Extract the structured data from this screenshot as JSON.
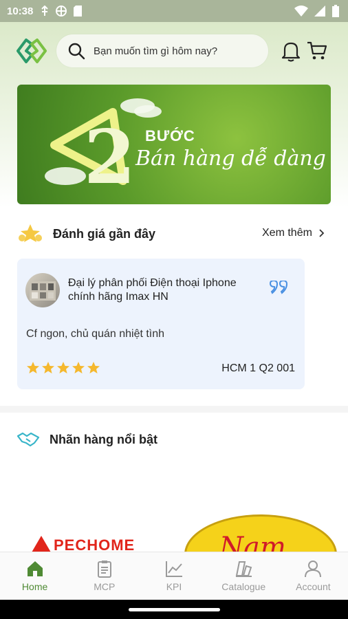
{
  "status_bar": {
    "time": "10:38"
  },
  "search": {
    "placeholder": "Bạn muốn tìm gì hôm nay?"
  },
  "banner": {
    "number": "2",
    "step_word": "BƯỚC",
    "tagline": "Bán hàng dễ dàng"
  },
  "reviews": {
    "title": "Đánh giá gần đây",
    "see_more": "Xem thêm",
    "items": [
      {
        "shop_name": "Đại lý phân phối Điện thoại Iphone chính hãng Imax HN",
        "comment": "Cf ngon, chủ quán nhiệt tình",
        "rating": 5,
        "store_code": "HCM 1 Q2 001"
      }
    ]
  },
  "brands": {
    "title": "Nhãn hàng nổi bật",
    "logos": [
      "PECHOME",
      "Nam buy"
    ]
  },
  "tabs": [
    {
      "label": "Home",
      "icon": "home-icon",
      "active": true
    },
    {
      "label": "MCP",
      "icon": "clipboard-icon",
      "active": false
    },
    {
      "label": "KPI",
      "icon": "chart-line-icon",
      "active": false
    },
    {
      "label": "Catalogue",
      "icon": "catalogue-icon",
      "active": false
    },
    {
      "label": "Account",
      "icon": "user-icon",
      "active": false
    }
  ],
  "colors": {
    "accent_green": "#4f8a34",
    "star": "#f5b82e",
    "quote_blue": "#4a90e2",
    "card_bg": "#edf3fd"
  }
}
